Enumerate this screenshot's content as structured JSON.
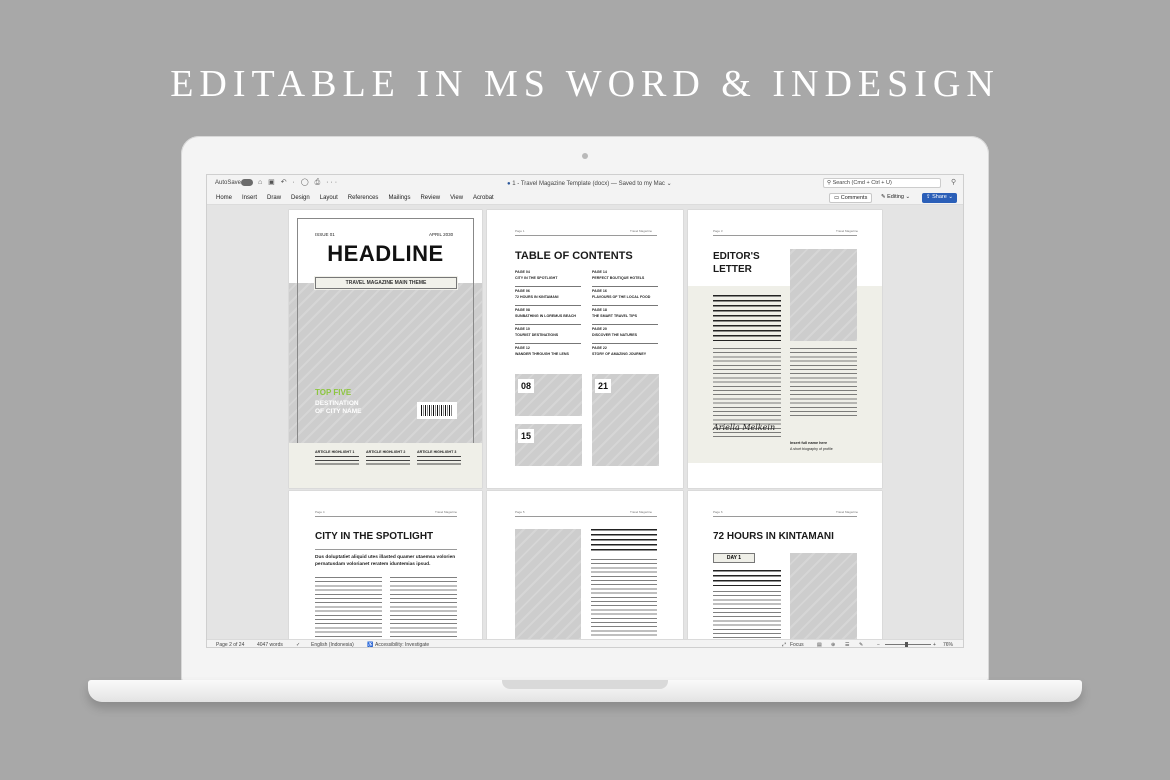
{
  "hero": {
    "title": "EDITABLE IN MS WORD & INDESIGN"
  },
  "titlebar": {
    "autosave_label": "AutoSave",
    "quick_icons": "⌂ ▣ ↶ · ◯ ⎙ ···",
    "doc_title": "1 - Travel Magazine Template (docx) — Saved to my Mac ⌄",
    "doc_icon": "●",
    "search_placeholder": "Search (Cmd + Ctrl + U)",
    "feedback_icon": "⚲"
  },
  "ribbon": {
    "tabs": [
      "Home",
      "Insert",
      "Draw",
      "Design",
      "Layout",
      "References",
      "Mailings",
      "Review",
      "View",
      "Acrobat"
    ],
    "comments_label": "Comments",
    "editing_label": "Editing",
    "share_label": "Share"
  },
  "pages": {
    "cover": {
      "issue": "ISSUE 01",
      "date": "APRIL 2030",
      "headline": "HEADLINE",
      "theme": "TRAVEL MAGAZINE MAIN THEME",
      "top_five": "TOP FIVE",
      "destination_line1": "DESTINATION",
      "destination_line2": "OF CITY NAME",
      "highlights": [
        "ARTICLE HIGHLIGHT 1",
        "ARTICLE HIGHLIGHT 2",
        "ARTICLE HIGHLIGHT 3"
      ]
    },
    "toc": {
      "runhead_left": "Page 1",
      "runhead_right": "Travel Magazine",
      "title": "TABLE OF CONTENTS",
      "entries_left": [
        {
          "page": "PAGE 04",
          "title": "CITY IN THE SPOTLIGHT"
        },
        {
          "page": "PAGE 06",
          "title": "72 HOURS IN KINTAMANI"
        },
        {
          "page": "PAGE 08",
          "title": "SUNBATHING IN LOREMUS BEACH"
        },
        {
          "page": "PAGE 10",
          "title": "TOURIST DESTINATIONS"
        },
        {
          "page": "PAGE 12",
          "title": "WANDER THROUGH THE LENS"
        }
      ],
      "entries_right": [
        {
          "page": "PAGE 14",
          "title": "PERFECT BOUTIQUE HOTELS"
        },
        {
          "page": "PAGE 16",
          "title": "FLAVOURS OF THE LOCAL FOOD"
        },
        {
          "page": "PAGE 18",
          "title": "THE SMART TRAVEL TIPS"
        },
        {
          "page": "PAGE 20",
          "title": "DISCOVER THE NATURES"
        },
        {
          "page": "PAGE 22",
          "title": "STORY OF AMAZING JOURNEY"
        }
      ],
      "badges": [
        "08",
        "21",
        "15"
      ]
    },
    "editor": {
      "runhead_left": "Page 3",
      "runhead_right": "Travel Magazine",
      "title_line1": "EDITOR'S",
      "title_line2": "LETTER",
      "signature": "Ariella Melkein",
      "sig_name": "Insert full name here",
      "sig_sub": "A short biography of profile"
    },
    "spotlight": {
      "runhead_left": "Page 4",
      "runhead_right": "Travel Magazine",
      "title": "CITY IN THE SPOTLIGHT",
      "lead": "Dus doluptatiet aliquid utes illasted quamer utaemsa volorien pernatusdam volorianet reratem iduntemias ipsud."
    },
    "page5": {
      "runhead_left": "Page 5",
      "runhead_right": "Travel Magazine"
    },
    "kintamani": {
      "runhead_left": "Page 6",
      "runhead_right": "Travel Magazine",
      "title": "72 HOURS IN KINTAMANI",
      "day_badge": "DAY 1"
    }
  },
  "statusbar": {
    "page_info": "Page 2 of 24",
    "word_count": "4047 words",
    "language": "English (Indonesia)",
    "accessibility": "Accessibility: Investigate",
    "focus_label": "Focus",
    "zoom_minus": "−",
    "zoom_plus": "+",
    "zoom_level": "76%"
  }
}
